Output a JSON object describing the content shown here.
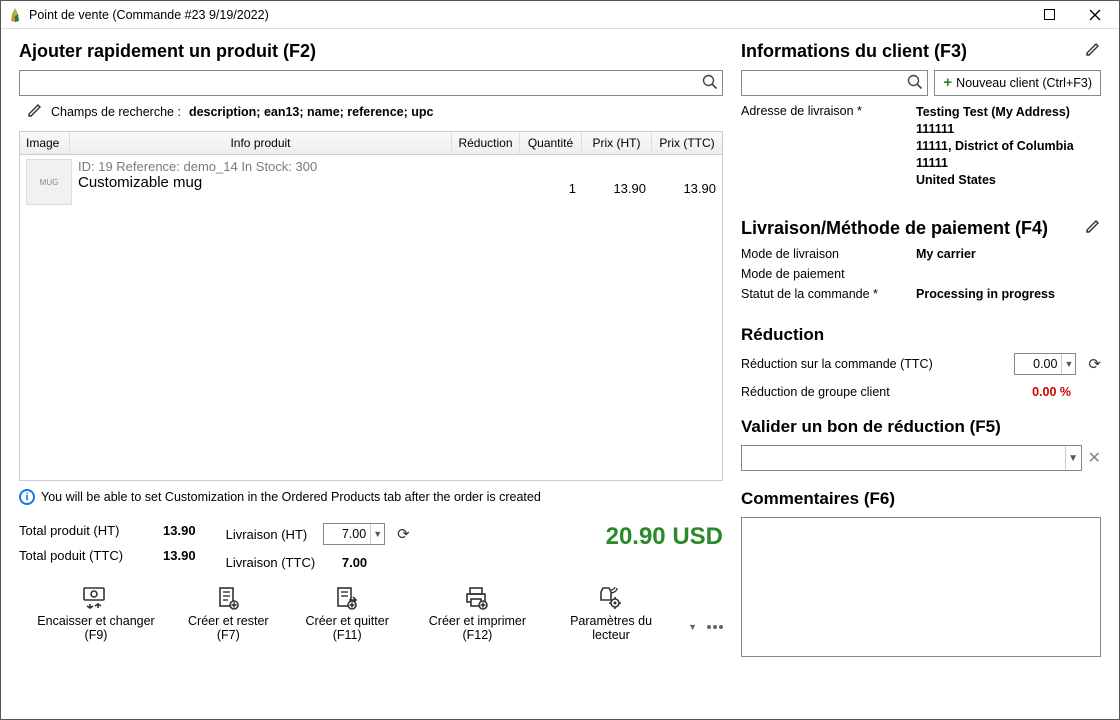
{
  "window": {
    "title": "Point de vente (Commande #23 9/19/2022)"
  },
  "left": {
    "quick_add_title": "Ajouter rapidement un produit (F2)",
    "search_fields_label": "Champs de recherche :",
    "search_fields_value": "description; ean13; name; reference; upc",
    "headers": {
      "image": "Image",
      "info": "Info produit",
      "discount": "Réduction",
      "qty": "Quantité",
      "price_ht": "Prix (HT)",
      "price_ttc": "Prix (TTC)"
    },
    "row": {
      "meta": "ID: 19 Reference: demo_14 In Stock: 300",
      "name": "Customizable mug",
      "qty": "1",
      "price_ht": "13.90",
      "price_ttc": "13.90"
    },
    "info_note": "You will be able to set Customization in the Ordered Products tab after the order is created",
    "totals": {
      "product_ht_label": "Total produit (HT)",
      "product_ht": "13.90",
      "product_ttc_label": "Total poduit (TTC)",
      "product_ttc": "13.90",
      "ship_ht_label": "Livraison (HT)",
      "ship_ht": "7.00",
      "ship_ttc_label": "Livraison (TTC)",
      "ship_ttc": "7.00",
      "grand": "20.90 USD"
    },
    "toolbar": {
      "cash": "Encaisser et changer (F9)",
      "create_stay": "Créer et rester (F7)",
      "create_quit": "Créer et quitter (F11)",
      "create_print": "Créer et imprimer (F12)",
      "reader_settings": "Paramètres du lecteur"
    }
  },
  "right": {
    "client_title": "Informations du client (F3)",
    "new_client_btn": "Nouveau client (Ctrl+F3)",
    "address_label": "Adresse de livraison *",
    "address": {
      "l1": "Testing Test (My Address)",
      "l2": "111111",
      "l3": "11111, District of Columbia 11111",
      "l4": "United States"
    },
    "delivery_title": "Livraison/Méthode de paiement (F4)",
    "delivery_mode_label": "Mode de livraison",
    "delivery_mode": "My carrier",
    "payment_mode_label": "Mode de paiement",
    "payment_mode": "",
    "order_status_label": "Statut de la commande *",
    "order_status": "Processing in progress",
    "discount_title": "Réduction",
    "discount_order_label": "Réduction sur la commande (TTC)",
    "discount_order_value": "0.00",
    "discount_group_label": "Réduction de groupe client",
    "discount_group_value": "0.00 %",
    "voucher_title": "Valider un bon de réduction (F5)",
    "comments_title": "Commentaires (F6)"
  }
}
